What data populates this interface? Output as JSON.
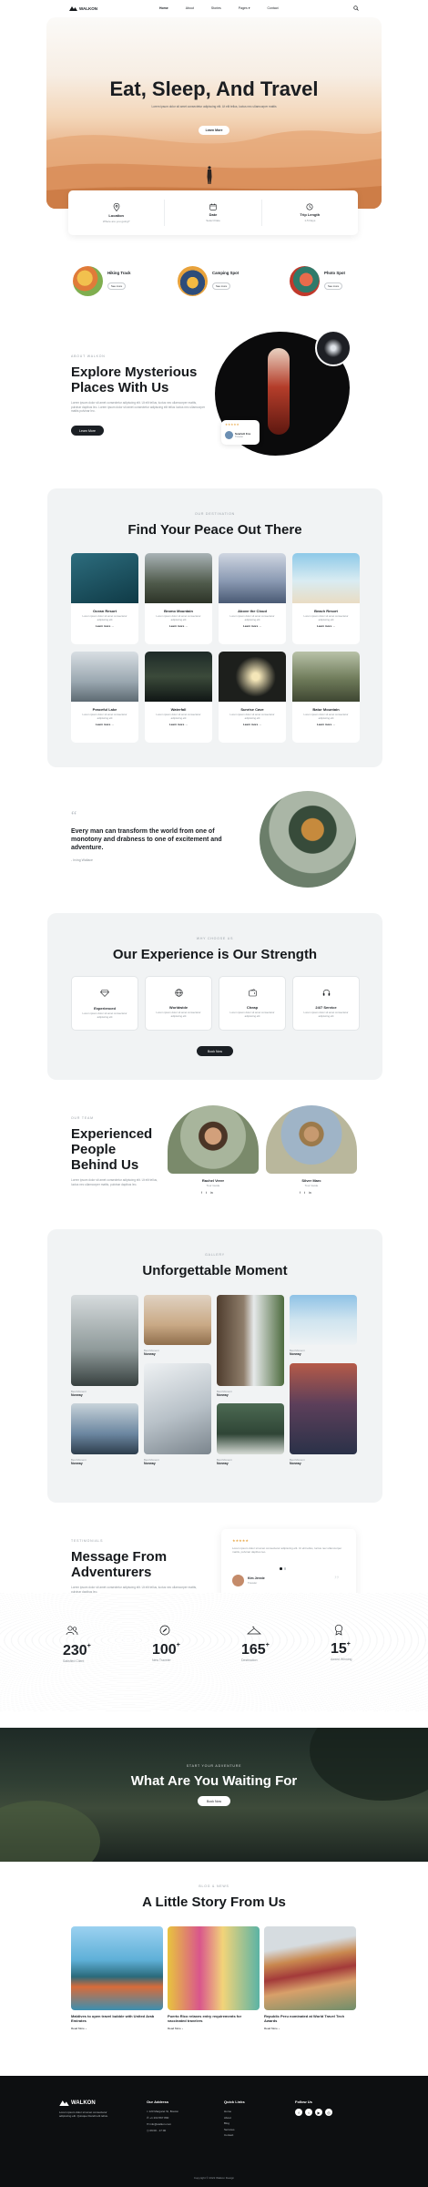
{
  "header": {
    "brand": "WALKON",
    "nav": [
      "Home",
      "About",
      "Stories",
      "Pages",
      "Contact"
    ],
    "nav_dropdown_index": 3
  },
  "hero": {
    "title": "Eat, Sleep, And Travel",
    "subtitle": "Lorem ipsum dolor sit amet consectetur adipiscing elit. Ut elit tellus, luctus nec ullamcorper mattis",
    "button": "Learn More"
  },
  "booking": [
    {
      "icon": "location-pin-icon",
      "label": "Location",
      "hint": "Where are you going?"
    },
    {
      "icon": "calendar-icon",
      "label": "Date",
      "hint": "Select Date"
    },
    {
      "icon": "clock-icon",
      "label": "Trip Length",
      "hint": "1-5 Days"
    }
  ],
  "features": [
    {
      "title": "Hiking Track",
      "badge": "See more"
    },
    {
      "title": "Camping Spot",
      "badge": "See more"
    },
    {
      "title": "Photo Spot",
      "badge": "See more"
    }
  ],
  "about": {
    "eyebrow": "ABOUT WALKON",
    "title": "Explore Mysterious Places With Us",
    "body": "Lorem ipsum dolor sit amet consectetur adipiscing elit. Ut elit tellus, luctus nec ullamcorper mattis, pulvinar dapibus leo. Lorem ipsum dolor sit amet consectetur adipiscing elit tellus luctus nec ullamcorper mattis pulvinar leo.",
    "button": "Learn More",
    "review_name": "Scarlett Fox",
    "review_role": "Traveler"
  },
  "destinations": {
    "eyebrow": "OUR DESTINATION",
    "title": "Find Your Peace Out There",
    "link": "Learn more",
    "items": [
      {
        "name": "Ocean Resort",
        "desc": "Lorem ipsum dolor sit amet consectetur adipiscing elit"
      },
      {
        "name": "Bromo Mountain",
        "desc": "Lorem ipsum dolor sit amet consectetur adipiscing elit"
      },
      {
        "name": "Above the Cloud",
        "desc": "Lorem ipsum dolor sit amet consectetur adipiscing elit"
      },
      {
        "name": "Beach Resort",
        "desc": "Lorem ipsum dolor sit amet consectetur adipiscing elit"
      },
      {
        "name": "Peaceful Lake",
        "desc": "Lorem ipsum dolor sit amet consectetur adipiscing elit"
      },
      {
        "name": "Waterfall",
        "desc": "Lorem ipsum dolor sit amet consectetur adipiscing elit"
      },
      {
        "name": "Sunrise Cave",
        "desc": "Lorem ipsum dolor sit amet consectetur adipiscing elit"
      },
      {
        "name": "Batur Mountain",
        "desc": "Lorem ipsum dolor sit amet consectetur adipiscing elit"
      }
    ]
  },
  "quote": {
    "text": "Every man can transform the world from one of monotony and drabness to one of excitement and adventure.",
    "author": "- Irving Wallace"
  },
  "why": {
    "eyebrow": "WHY CHOOSE US",
    "title": "Our Experience is Our Strength",
    "button": "Book Now",
    "items": [
      {
        "icon": "diamond-icon",
        "title": "Experienced",
        "desc": "Lorem ipsum dolor sit amet consectetur adipiscing elit"
      },
      {
        "icon": "globe-icon",
        "title": "Worldwide",
        "desc": "Lorem ipsum dolor sit amet consectetur adipiscing elit"
      },
      {
        "icon": "wallet-icon",
        "title": "Cheap",
        "desc": "Lorem ipsum dolor sit amet consectetur adipiscing elit"
      },
      {
        "icon": "headset-icon",
        "title": "24/7 Service",
        "desc": "Lorem ipsum dolor sit amet consectetur adipiscing elit"
      }
    ]
  },
  "team": {
    "eyebrow": "OUR TEAM",
    "title": "Experienced People Behind Us",
    "body": "Lorem ipsum dolor sit amet consectetur adipiscing elit. Ut elit tellus, luctus nec ullamcorper mattis, pulvinar dapibus leo.",
    "members": [
      {
        "name": "Rachel Verer",
        "role": "Tour Guide",
        "socials": [
          "f",
          "t",
          "in"
        ]
      },
      {
        "name": "Silver Marc",
        "role": "Tour Guide",
        "socials": [
          "f",
          "t",
          "in"
        ]
      }
    ]
  },
  "gallery": {
    "eyebrow": "GALLERY",
    "title": "Unforgettable Moment",
    "captions": [
      {
        "eyebrow": "Best Moment",
        "place": "Norway"
      },
      {
        "eyebrow": "Best Moment",
        "place": "Norway"
      },
      {
        "eyebrow": "Best Moment",
        "place": "Norway"
      },
      {
        "eyebrow": "Best Moment",
        "place": "Norway"
      },
      {
        "eyebrow": "Best Moment",
        "place": "Norway"
      },
      {
        "eyebrow": "Best Moment",
        "place": "Norway"
      },
      {
        "eyebrow": "Best Moment",
        "place": "Norway"
      },
      {
        "eyebrow": "Best Moment",
        "place": "Norway"
      }
    ]
  },
  "testimonials": {
    "eyebrow": "TESTIMONIALS",
    "title": "Message From Adventurers",
    "body": "Lorem ipsum dolor sit amet consectetur adipiscing elit. Ut elit tellus, luctus nec ullamcorper mattis, pulvinar dapibus leo.",
    "card_text": "Lorem ipsum dolor sit amet consectetur adipiscing elit. Ut elit tellus, luctus nec ullamcorper mattis, pulvinar dapibus leo.",
    "card_name": "Kim Jennie",
    "card_role": "Traveler"
  },
  "stats": [
    {
      "value": "230",
      "suffix": "+",
      "label": "Satisfied Client"
    },
    {
      "value": "100",
      "suffix": "+",
      "label": "New Traveler"
    },
    {
      "value": "165",
      "suffix": "+",
      "label": "Destination"
    },
    {
      "value": "15",
      "suffix": "+",
      "label": "Award Winning"
    }
  ],
  "cta": {
    "eyebrow": "START YOUR ADVENTURE",
    "title": "What Are You Waiting For",
    "button": "Book Now"
  },
  "blog": {
    "eyebrow": "BLOG & NEWS",
    "title": "A Little Story From Us",
    "read": "Read More",
    "posts": [
      {
        "title": "Maldives to open travel bubble with United Arab Emirates"
      },
      {
        "title": "Puerto Rico relaxes entry requirements for vaccinated travelers"
      },
      {
        "title": "Republic Peru nominated at World Travel Tech Awards"
      }
    ]
  },
  "footer": {
    "brand": "WALKON",
    "desc": "Lorem ipsum dolor sit amet consectetur adipiscing elit. Quisque blandit elit tellus.",
    "address_title": "Our Address",
    "address": [
      "123 Margaret St, Boston",
      "+1 234 567 890",
      "info@walkon.com",
      "09:00 - 17:00"
    ],
    "links_title": "Quick Links",
    "links": [
      "Home",
      "About",
      "Blog",
      "Services",
      "Contact"
    ],
    "follow_title": "Follow Us",
    "copyright": "Copyright © 2022 Walkon Design"
  },
  "colors": {
    "dark": "#1b1f24",
    "panel": "#f1f3f4",
    "accent": "#e9a94b",
    "footer": "#0d0f11"
  }
}
